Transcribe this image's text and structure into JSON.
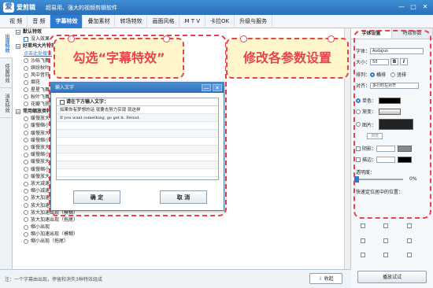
{
  "app": {
    "logo_text": "爱",
    "name": "爱剪辑",
    "slogan": "超易用、强大的视频剪辑软件",
    "win_controls": [
      "—",
      "□",
      "✕"
    ]
  },
  "menu": [
    "视 频",
    "音 频",
    "字幕特效",
    "叠加素材",
    "转场特效",
    "画面风格",
    "M T V",
    "卡拉OK",
    "升级与服务"
  ],
  "menu_active": 2,
  "vtabs": [
    "出现特效",
    "停留特效",
    "消失特效"
  ],
  "vtab_active": 0,
  "effect_list": {
    "group1": "默认特效",
    "item_none": "没入效果",
    "group2": "好莱坞大片特效",
    "link": "点击此处搜索",
    "items_a": [
      "沙砾飞舞",
      "缤纷秋叶",
      "风中音符",
      "烟花",
      "星星飞舞",
      "秋叶飞舞",
      "花瓣飞扬"
    ],
    "group3": "常用缩放类特效",
    "items_b": [
      "缓慢放大",
      "缓慢缩小",
      "缓慢放大",
      "缓慢缩小",
      "缓慢放大",
      "缓慢缩小",
      "缓慢放大",
      "缓慢缩小",
      "缓慢放大",
      "放大减速",
      "缩小减速",
      "放大加速出现",
      "放大加速出现",
      "放大加速出现（模糊）",
      "放大加速出现（拖尾）",
      "缩小出现",
      "缩小加速出现（模糊）",
      "缩小出现（拖尾）"
    ]
  },
  "callouts": {
    "left": "勾选“字幕特效”",
    "right": "修改各参数设置"
  },
  "dialog": {
    "title": "输入文字",
    "controls": [
      "—",
      "✕"
    ],
    "prompt": "请在下方输入文字：",
    "lines": [
      "如果你有梦想的话 就要去努力实现 就这样",
      "If you want something, go get it. Period."
    ],
    "ok": "确  定",
    "cancel": "取  消"
  },
  "right_panel": {
    "tabs": [
      "字体设置",
      "特效参数"
    ],
    "font_label": "字体：",
    "font_value": "AsdaJun",
    "size_label": "大小：",
    "size_value": "50",
    "bold": "B",
    "italic": "I",
    "layout_label": "排列：",
    "layout_h": "横排",
    "layout_v": "竖排",
    "align_label": "对齐：",
    "align_value": "多行时左对齐",
    "color_single": "单色：",
    "color_gradient": "渐变：",
    "color_image": "图片：",
    "browse": "浏览",
    "shadow_label": "阴影：",
    "stroke_label": "描边：",
    "opacity_label": "透明度：",
    "opacity_value": "0%",
    "position_label": "快速定位居中的位置："
  },
  "preview_button": "播放试试",
  "status": {
    "text": "注：一个字幕由出现，停留和消失3种特效组成",
    "collapse": "收起"
  },
  "colors": {
    "accent": "#2d7bd0",
    "callout_red": "#e8424e",
    "callout_bg": "#fff6cc"
  }
}
